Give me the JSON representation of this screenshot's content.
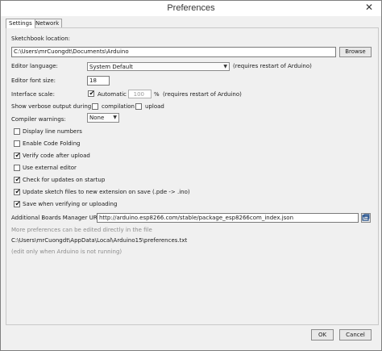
{
  "window": {
    "title": "Preferences",
    "close_glyph": "✕"
  },
  "tabs": [
    {
      "label": "Settings",
      "active": true
    },
    {
      "label": "Network",
      "active": false
    }
  ],
  "sketchbook": {
    "label": "Sketchbook location:",
    "value": "C:\\Users\\mrCuongdt\\Documents\\Arduino",
    "browse_label": "Browse"
  },
  "editor_language": {
    "label": "Editor language:",
    "value": "System Default",
    "note": "(requires restart of Arduino)"
  },
  "font_size": {
    "label": "Editor font size:",
    "value": "18"
  },
  "interface_scale": {
    "label": "Interface scale:",
    "automatic_label": "Automatic",
    "automatic_checked": true,
    "value": "100",
    "unit": "%",
    "note": "(requires restart of Arduino)"
  },
  "verbose": {
    "label": "Show verbose output during:",
    "compilation_label": "compilation",
    "compilation_checked": false,
    "upload_label": "upload",
    "upload_checked": false
  },
  "compiler_warnings": {
    "label": "Compiler warnings:",
    "value": "None"
  },
  "checkboxes": [
    {
      "label": "Display line numbers",
      "checked": false
    },
    {
      "label": "Enable Code Folding",
      "checked": false
    },
    {
      "label": "Verify code after upload",
      "checked": true
    },
    {
      "label": "Use external editor",
      "checked": false
    },
    {
      "label": "Check for updates on startup",
      "checked": true
    },
    {
      "label": "Update sketch files to new extension on save (.pde -> .ino)",
      "checked": true
    },
    {
      "label": "Save when verifying or uploading",
      "checked": true
    }
  ],
  "boards_manager": {
    "label": "Additional Boards Manager URLs:",
    "value": "http://arduino.esp8266.com/stable/package_esp8266com_index.json"
  },
  "more_prefs": "More preferences can be edited directly in the file",
  "prefs_path": "C:\\Users\\mrCuongdt\\AppData\\Local\\Arduino15\\preferences.txt",
  "edit_note": "(edit only when Arduino is not running)",
  "buttons": {
    "ok": "OK",
    "cancel": "Cancel"
  },
  "check_glyph": "✔"
}
